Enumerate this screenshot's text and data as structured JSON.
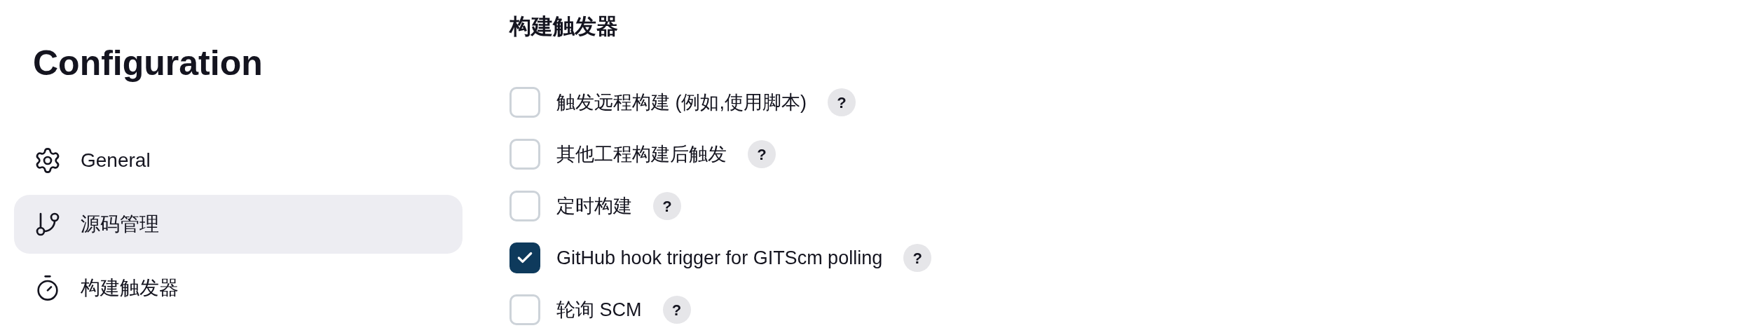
{
  "sidebar": {
    "title": "Configuration",
    "items": [
      {
        "label": "General",
        "selected": false
      },
      {
        "label": "源码管理",
        "selected": true
      },
      {
        "label": "构建触发器",
        "selected": false
      }
    ]
  },
  "section": {
    "title": "构建触发器",
    "options": [
      {
        "label": "触发远程构建 (例如,使用脚本)",
        "checked": false,
        "help": "?"
      },
      {
        "label": "其他工程构建后触发",
        "checked": false,
        "help": "?"
      },
      {
        "label": "定时构建",
        "checked": false,
        "help": "?"
      },
      {
        "label": "GitHub hook trigger for GITScm polling",
        "checked": true,
        "help": "?"
      },
      {
        "label": "轮询 SCM",
        "checked": false,
        "help": "?"
      }
    ]
  }
}
